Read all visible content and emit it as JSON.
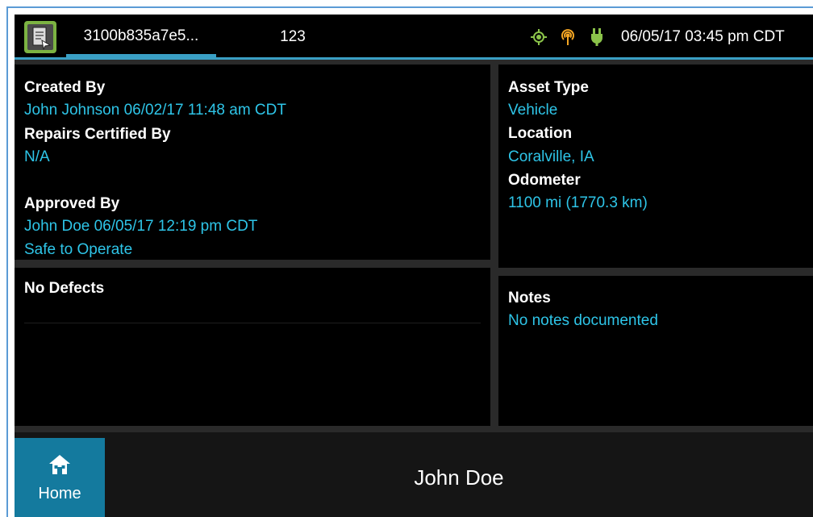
{
  "header": {
    "app_icon": "inspection-app-icon",
    "tab_id_label": "3100b835a7e5...",
    "tab_number_label": "123",
    "status_icons": [
      "gps-locator-icon",
      "signal-icon",
      "power-plug-icon"
    ],
    "datetime": "06/05/17 03:45 pm CDT"
  },
  "approvals": {
    "created_by_label": "Created By",
    "created_by_value": "John Johnson 06/02/17 11:48 am CDT",
    "repairs_label": "Repairs Certified By",
    "repairs_value": "N/A",
    "approved_by_label": "Approved By",
    "approved_by_value": "John Doe 06/05/17 12:19 pm CDT",
    "status_value": "Safe to Operate"
  },
  "asset": {
    "type_label": "Asset Type",
    "type_value": "Vehicle",
    "location_label": "Location",
    "location_value": "Coralville, IA",
    "odometer_label": "Odometer",
    "odometer_value": "1100 mi (1770.3 km)"
  },
  "defects": {
    "title": "No Defects"
  },
  "notes": {
    "title": "Notes",
    "value": "No notes documented"
  },
  "footer": {
    "home_label": "Home",
    "driver_name": "John Doe"
  },
  "colors": {
    "accent": "#3a9fc4",
    "value_text": "#2ec5e8",
    "home_button": "#147a9e",
    "status_icon_green": "#8bc34a",
    "status_icon_orange": "#f5a623"
  }
}
